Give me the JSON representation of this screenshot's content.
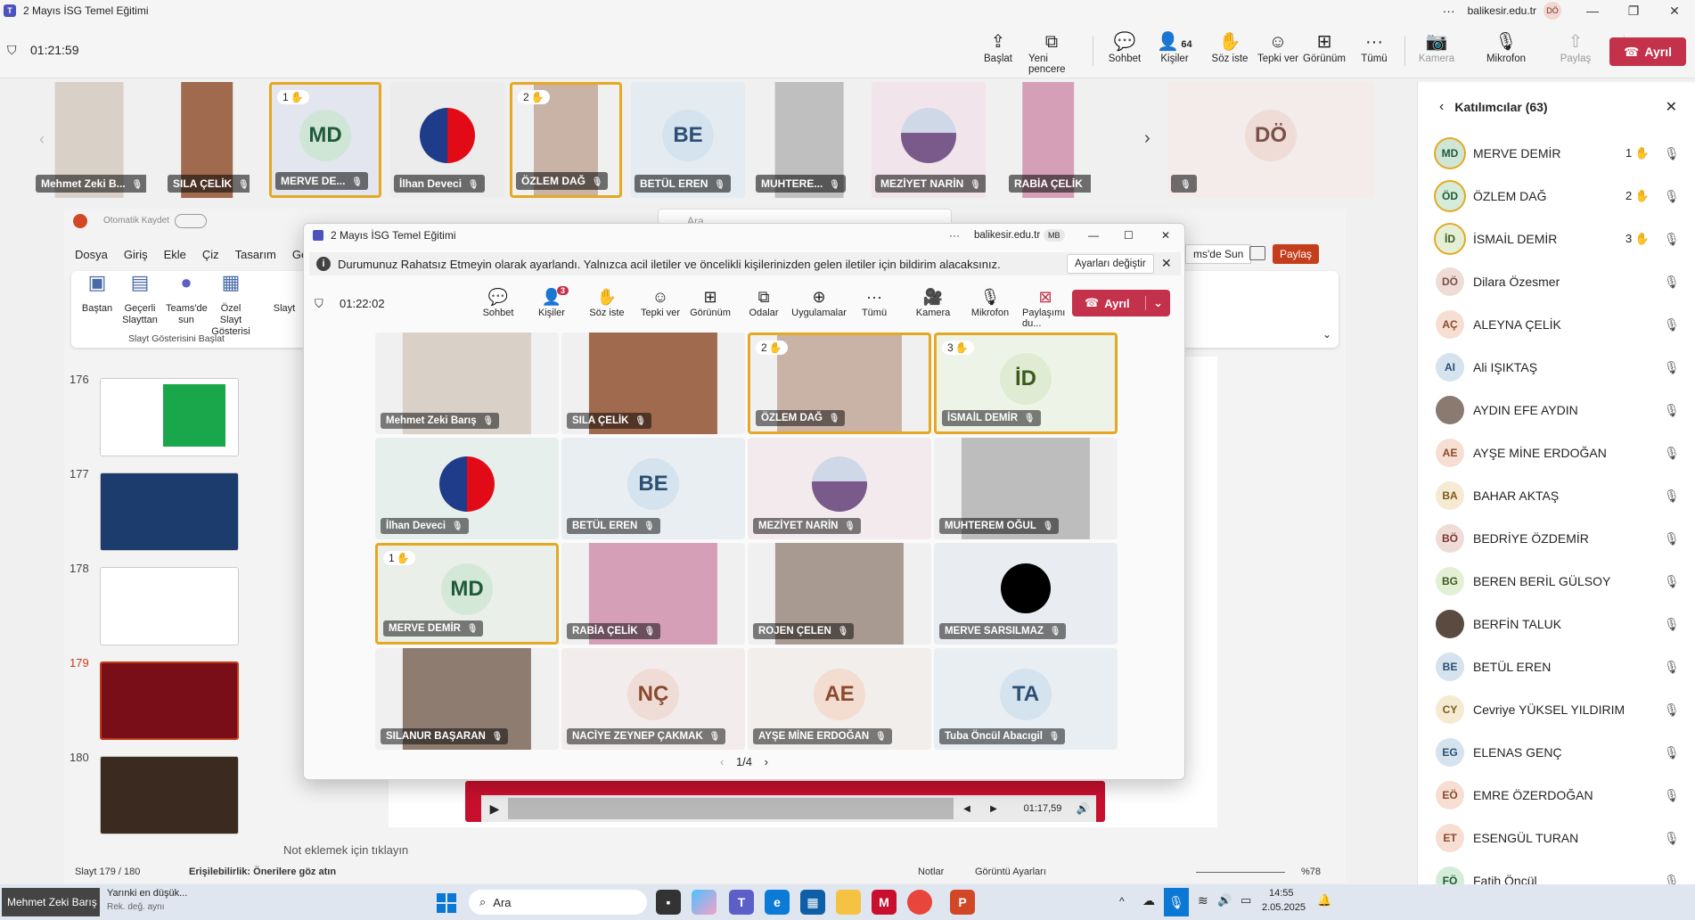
{
  "window": {
    "title": "2 Mayıs İSG Temel Eğitimi",
    "org": "balikesir.edu.tr",
    "user_initials": "DÖ"
  },
  "meeting": {
    "timer": "01:21:59",
    "tools": [
      {
        "label": "Başlat",
        "icon": "share-screen-icon"
      },
      {
        "label": "Yeni pencere",
        "icon": "new-window-icon"
      },
      {
        "label": "Sohbet",
        "icon": "chat-icon"
      },
      {
        "label": "Kişiler",
        "icon": "people-icon",
        "count": "64"
      },
      {
        "label": "Söz iste",
        "icon": "raise-hand-icon"
      },
      {
        "label": "Tepki ver",
        "icon": "reaction-icon"
      },
      {
        "label": "Görünüm",
        "icon": "view-icon"
      },
      {
        "label": "Tümü",
        "icon": "more-icon"
      },
      {
        "label": "Kamera",
        "icon": "camera-off-icon"
      },
      {
        "label": "Mikrofon",
        "icon": "mic-off-icon"
      },
      {
        "label": "Paylaş",
        "icon": "share-icon"
      }
    ],
    "leave_label": "Ayrıl"
  },
  "strip": [
    {
      "name": "Mehmet Zeki B...",
      "kind": "photo",
      "color": "#d9d0c8"
    },
    {
      "name": "SILA ÇELİK",
      "kind": "photo",
      "color": "#a06a4e"
    },
    {
      "name": "MERVE DE...",
      "kind": "initials",
      "initials": "MD",
      "hand": "1",
      "bg": "#e3e6ef",
      "fg": "#1f5a3a",
      "avbg": "#cfe6d6"
    },
    {
      "name": "İlhan Deveci",
      "kind": "flag",
      "color": "#ececec"
    },
    {
      "name": "ÖZLEM DAĞ",
      "kind": "photo",
      "hand": "2",
      "color": "#c9b3a6"
    },
    {
      "name": "BETÜL EREN",
      "kind": "initials",
      "initials": "BE",
      "bg": "#e4ecf2",
      "fg": "#2d4f72",
      "avbg": "#d5e3ef"
    },
    {
      "name": "MUHTERE...",
      "kind": "photo",
      "color": "#bfbfbf"
    },
    {
      "name": "MEZİYET NARİN",
      "kind": "circle-photo",
      "color": "#f1e4ea"
    },
    {
      "name": "RABİA ÇELİK",
      "kind": "photo",
      "color": "#d59fb8"
    },
    {
      "name": "",
      "kind": "initials",
      "initials": "DÖ",
      "bg": "#f3ecea",
      "fg": "#7a5148",
      "avbg": "#efdcd7"
    }
  ],
  "panel": {
    "title": "Katılımcılar (63)",
    "people": [
      {
        "initials": "MD",
        "name": "MERVE DEMİR",
        "hand": "1",
        "bg": "#cfe6d6",
        "fg": "#1f5a3a"
      },
      {
        "initials": "ÖD",
        "name": "ÖZLEM DAĞ",
        "hand": "2",
        "bg": "#d4ecd9",
        "fg": "#1f5a3a"
      },
      {
        "initials": "İD",
        "name": "İSMAİL DEMİR",
        "hand": "3",
        "bg": "#e3f0d6",
        "fg": "#3c5a1f"
      },
      {
        "initials": "DÖ",
        "name": "Dilara Özesmer",
        "bg": "#efdcd7",
        "fg": "#7a5148"
      },
      {
        "initials": "AÇ",
        "name": "ALEYNA ÇELİK",
        "bg": "#f6dfd2",
        "fg": "#8a4a2e"
      },
      {
        "initials": "AI",
        "name": "Ali IŞIKTAŞ",
        "bg": "#d5e3ef",
        "fg": "#2d4f72"
      },
      {
        "initials": "",
        "name": "AYDIN EFE AYDIN",
        "bg": "#8a7a70",
        "fg": "#fff"
      },
      {
        "initials": "AE",
        "name": "AYŞE MİNE ERDOĞAN",
        "bg": "#f6dfd2",
        "fg": "#8a4a2e"
      },
      {
        "initials": "BA",
        "name": "BAHAR AKTAŞ",
        "bg": "#f6ead2",
        "fg": "#7a5a1f"
      },
      {
        "initials": "BÖ",
        "name": "BEDRİYE ÖZDEMİR",
        "bg": "#efdcd7",
        "fg": "#7a3a2e"
      },
      {
        "initials": "BG",
        "name": "BEREN BERİL GÜLSOY",
        "bg": "#e3f0d6",
        "fg": "#3c5a1f"
      },
      {
        "initials": "",
        "name": "BERFİN TALUK",
        "bg": "#5a4a40",
        "fg": "#fff"
      },
      {
        "initials": "BE",
        "name": "BETÜL EREN",
        "bg": "#d5e3ef",
        "fg": "#2d4f72"
      },
      {
        "initials": "CY",
        "name": "Cevriye YÜKSEL YILDIRIM",
        "bg": "#f6ead2",
        "fg": "#7a5a1f"
      },
      {
        "initials": "EG",
        "name": "ELENAS GENÇ",
        "bg": "#d5e3ef",
        "fg": "#2d4f72"
      },
      {
        "initials": "EÖ",
        "name": "EMRE ÖZERDOĞAN",
        "bg": "#f6dfd2",
        "fg": "#8a4a2e"
      },
      {
        "initials": "ET",
        "name": "ESENGÜL TURAN",
        "bg": "#f6dfd2",
        "fg": "#8a4a2e"
      },
      {
        "initials": "FÖ",
        "name": "Fatih Öncül",
        "bg": "#d4ecd9",
        "fg": "#1f5a3a"
      }
    ]
  },
  "ppt": {
    "autosave": "Otomatik Kaydet",
    "search": "Ara",
    "tabs": [
      "Dosya",
      "Giriş",
      "Ekle",
      "Çiz",
      "Tasarım",
      "Geçiş"
    ],
    "ribbon": [
      "Baştan",
      "Geçerli Slayttan",
      "Teams'de sun",
      "Özel Slayt Gösterisi",
      "Slayt"
    ],
    "ribbon_group": "Slayt Gösterisini Başlat",
    "teams_present": "ms'de Sun",
    "share": "Paylaş",
    "slides": [
      "176",
      "177",
      "178",
      "179",
      "180"
    ],
    "notes_placeholder": "Not eklemek için tıklayın",
    "status_slide": "Slayt 179 / 180",
    "accessibility": "Erişilebilirlik: Önerilere göz atın",
    "notes": "Notlar",
    "display": "Görüntü Ayarları",
    "zoom": "%78",
    "video_time": "01:17,59"
  },
  "popup": {
    "title": "2 Mayıs İSG Temel Eğitimi",
    "org": "balikesir.edu.tr",
    "user": "MB",
    "notice": "Durumunuz Rahatsız Etmeyin olarak ayarlandı. Yalnızca acil iletiler ve öncelikli kişilerinizden gelen iletiler için bildirim alacaksınız.",
    "notice_btn": "Ayarları değiştir",
    "timer": "01:22:02",
    "tools": [
      "Sohbet",
      "Kişiler",
      "Söz iste",
      "Tepki ver",
      "Görünüm",
      "Odalar",
      "Uygulamalar",
      "Tümü",
      "Kamera",
      "Mikrofon",
      "Paylaşımı du..."
    ],
    "people_badge": "3",
    "leave": "Ayrıl",
    "pager": "1/4",
    "grid": [
      {
        "name": "Mehmet Zeki Barış",
        "kind": "photo",
        "color": "#d9d0c8"
      },
      {
        "name": "SILA ÇELİK",
        "kind": "photo",
        "color": "#a06a4e"
      },
      {
        "name": "ÖZLEM DAĞ",
        "kind": "photo",
        "hand": "2",
        "color": "#c9b3a6"
      },
      {
        "name": "İSMAİL DEMİR",
        "kind": "initials",
        "initials": "İD",
        "hand": "3",
        "bg": "#eef3e8",
        "fg": "#3c5a1f",
        "avbg": "#dfebd2"
      },
      {
        "name": "İlhan Deveci",
        "kind": "flag",
        "color": "#e7efec"
      },
      {
        "name": "BETÜL EREN",
        "kind": "initials",
        "initials": "BE",
        "bg": "#e8eef2",
        "fg": "#2d4f72",
        "avbg": "#d5e3ef"
      },
      {
        "name": "MEZİYET NARİN",
        "kind": "circle-photo",
        "color": "#f3eaee"
      },
      {
        "name": "MUHTEREM OĞUL",
        "kind": "photo",
        "color": "#bdbdbd"
      },
      {
        "name": "MERVE DEMİR",
        "kind": "initials",
        "initials": "MD",
        "hand": "1",
        "bg": "#eaefe9",
        "fg": "#1f5a3a",
        "avbg": "#d4e8d8"
      },
      {
        "name": "RABİA ÇELİK",
        "kind": "photo",
        "color": "#d59fb8"
      },
      {
        "name": "ROJEN ÇELEN",
        "kind": "photo",
        "color": "#a89a90"
      },
      {
        "name": "MERVE SARSILMAZ",
        "kind": "black-circle",
        "color": "#e9edf1"
      },
      {
        "name": "SILANUR BAŞARAN",
        "kind": "photo",
        "color": "#8e7c70"
      },
      {
        "name": "NACİYE ZEYNEP ÇAKMAK",
        "kind": "initials",
        "initials": "NÇ",
        "bg": "#f3ecec",
        "fg": "#8a4a2e",
        "avbg": "#efdcd7"
      },
      {
        "name": "AYŞE MİNE ERDOĞAN",
        "kind": "initials",
        "initials": "AE",
        "bg": "#f1eeec",
        "fg": "#8a4a2e",
        "avbg": "#f3dcd0"
      },
      {
        "name": "Tuba Öncül Abacıgil",
        "kind": "initials",
        "initials": "TA",
        "bg": "#e9eef2",
        "fg": "#2d4f72",
        "avbg": "#d5e3ef"
      }
    ]
  },
  "taskbar": {
    "user": "Mehmet Zeki Barış",
    "notify_title": "Yarınki en düşük...",
    "notify_sub": "Rek. değ. aynı",
    "search": "Ara",
    "time": "14:55",
    "date": "2.05.2025"
  }
}
